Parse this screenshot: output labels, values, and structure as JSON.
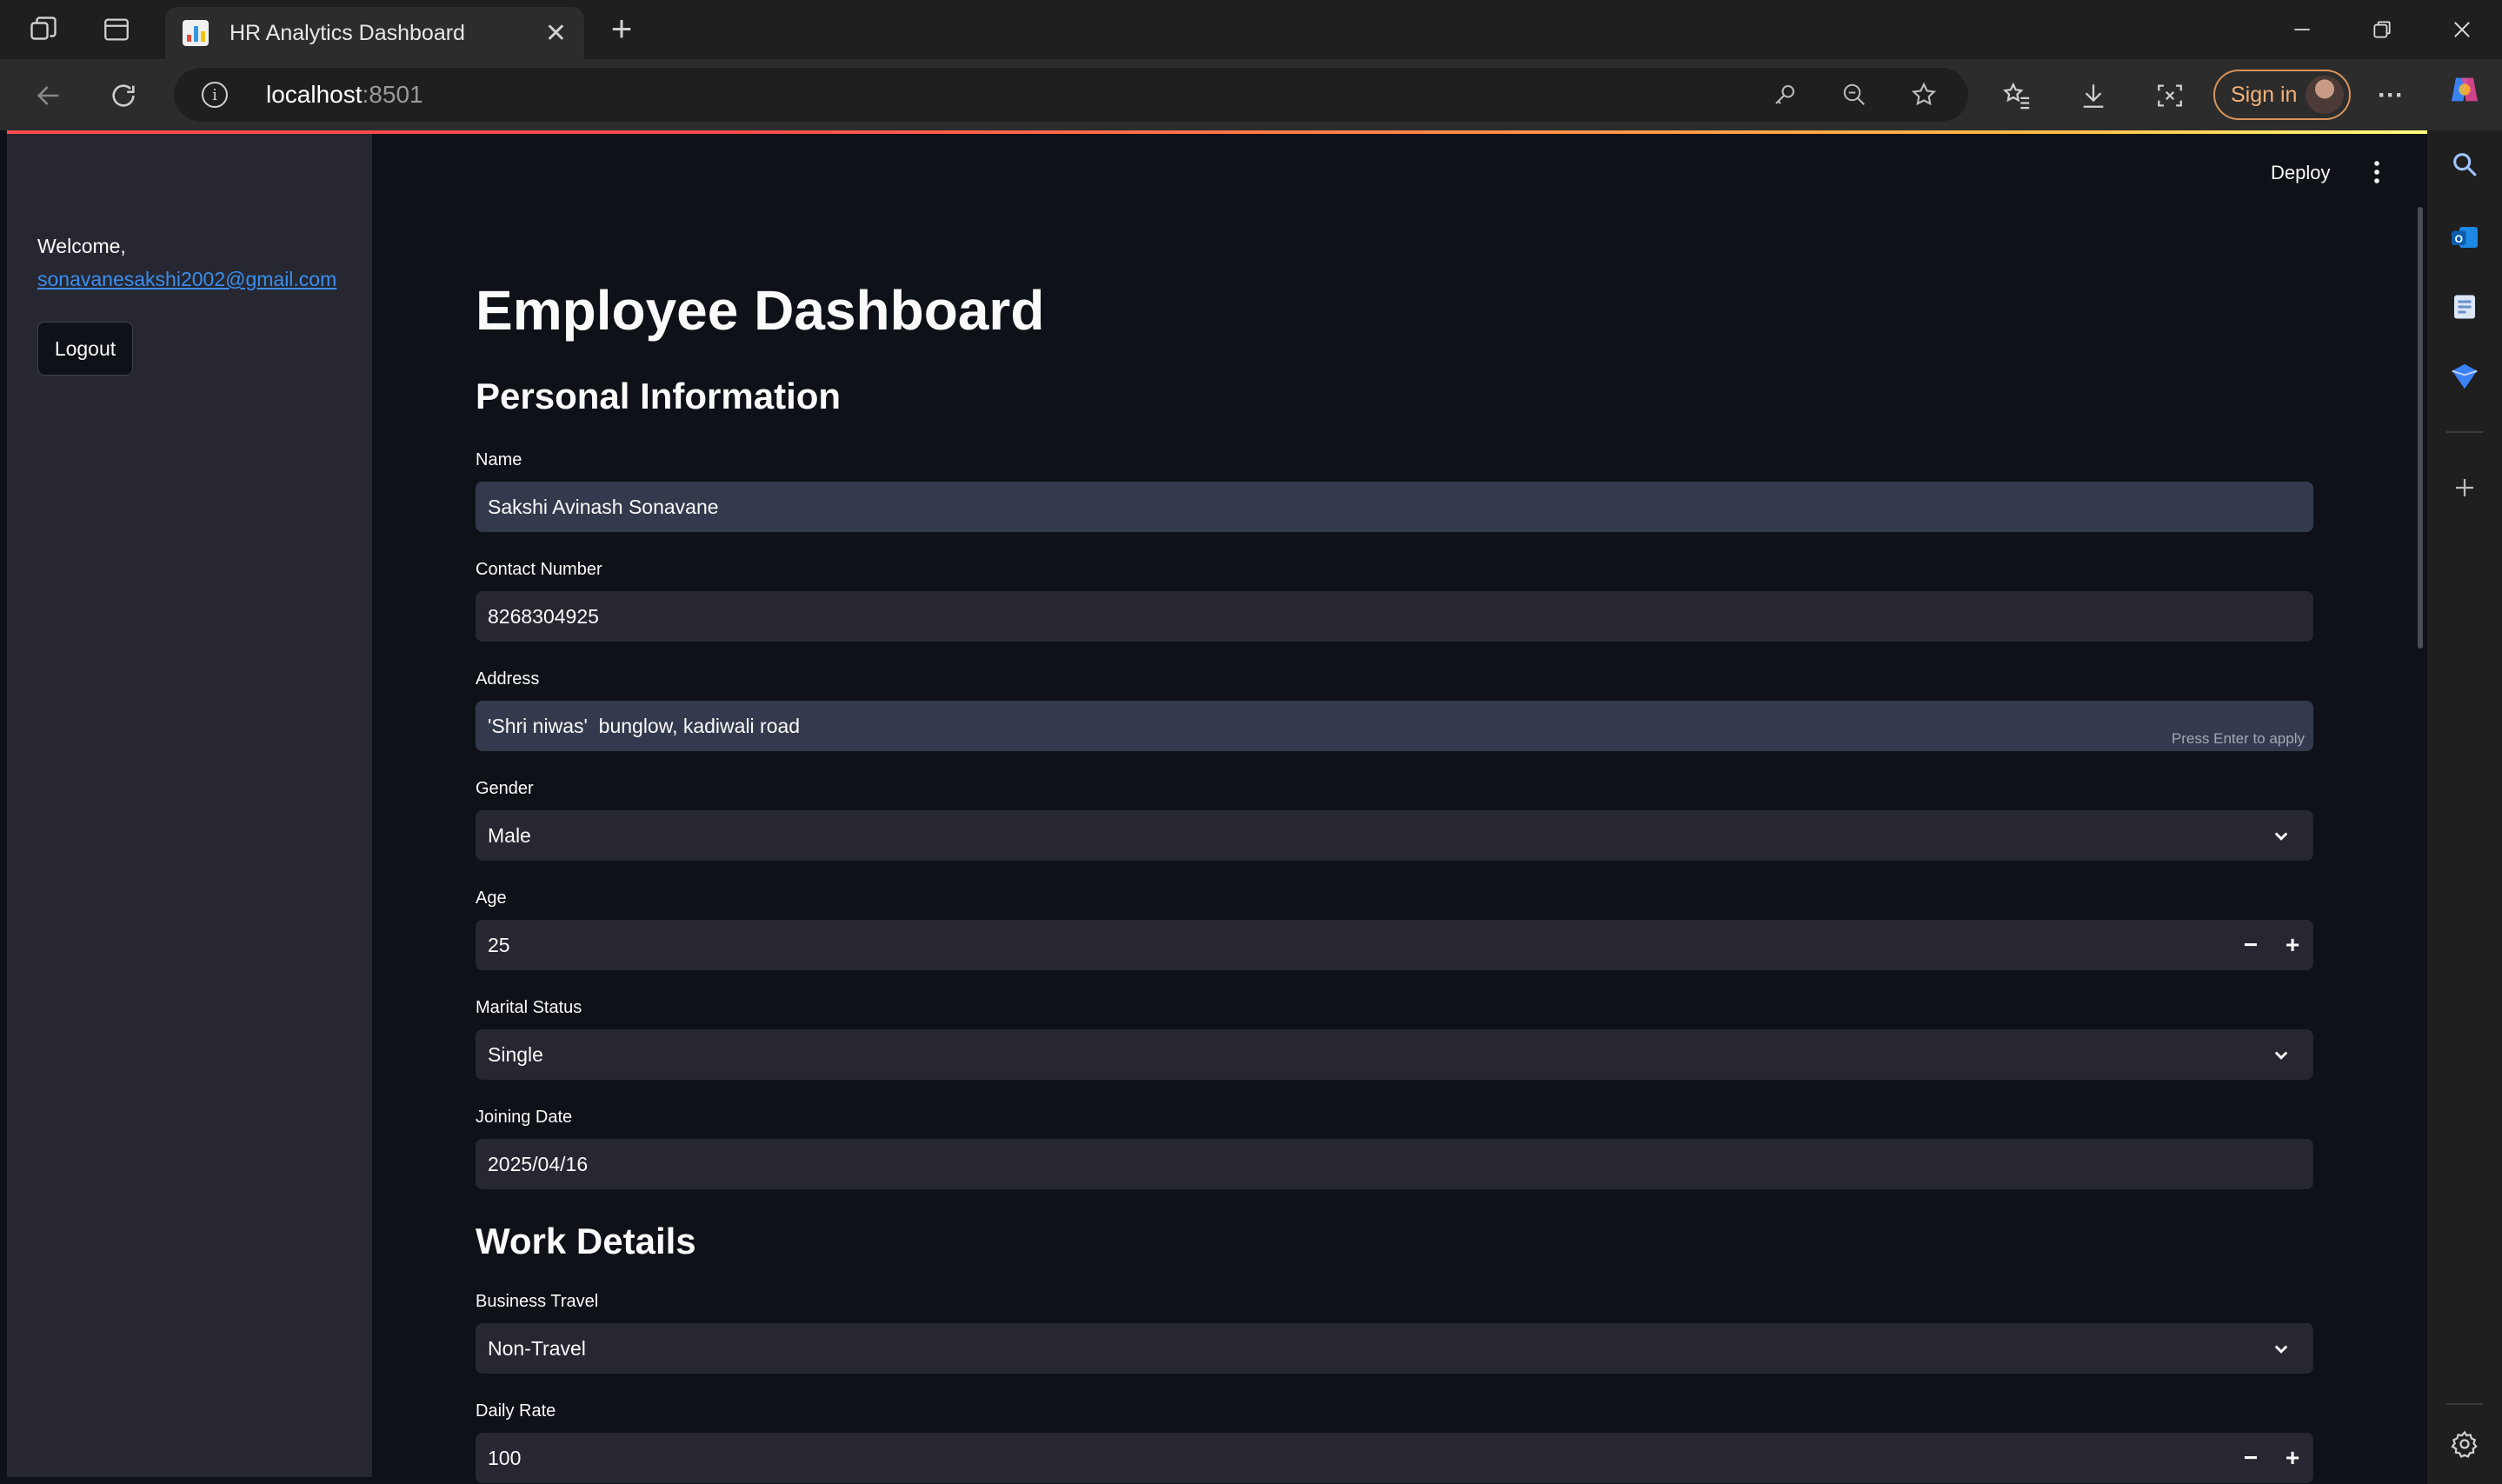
{
  "browser": {
    "tab_title": "HR Analytics Dashboard",
    "tab_close": "✕",
    "new_tab": "+",
    "url_host": "localhost",
    "url_port": ":8501",
    "sign_in": "Sign in",
    "more": "···"
  },
  "sidebar": {
    "welcome": "Welcome,",
    "email": "sonavanesakshi2002@gmail.com",
    "logout": "Logout"
  },
  "toolbar": {
    "deploy": "Deploy"
  },
  "page": {
    "title": "Employee Dashboard"
  },
  "personal": {
    "heading": "Personal Information",
    "name_label": "Name",
    "name_value": "Sakshi Avinash Sonavane",
    "contact_label": "Contact Number",
    "contact_value": "8268304925",
    "address_label": "Address",
    "address_value": "'Shri niwas'  bunglow, kadiwali road",
    "address_hint": "Press Enter to apply",
    "gender_label": "Gender",
    "gender_value": "Male",
    "age_label": "Age",
    "age_value": "25",
    "marital_label": "Marital Status",
    "marital_value": "Single",
    "joining_label": "Joining Date",
    "joining_value": "2025/04/16"
  },
  "work": {
    "heading": "Work Details",
    "travel_label": "Business Travel",
    "travel_value": "Non-Travel",
    "rate_label": "Daily Rate",
    "rate_value": "100"
  },
  "stepper": {
    "minus": "−",
    "plus": "+"
  },
  "colors": {
    "background": "#0e1117",
    "sidebar": "#262730",
    "input": "#262730",
    "input_active": "#343a4d",
    "link": "#3b8ef0",
    "accent": "#ff4b4b"
  }
}
